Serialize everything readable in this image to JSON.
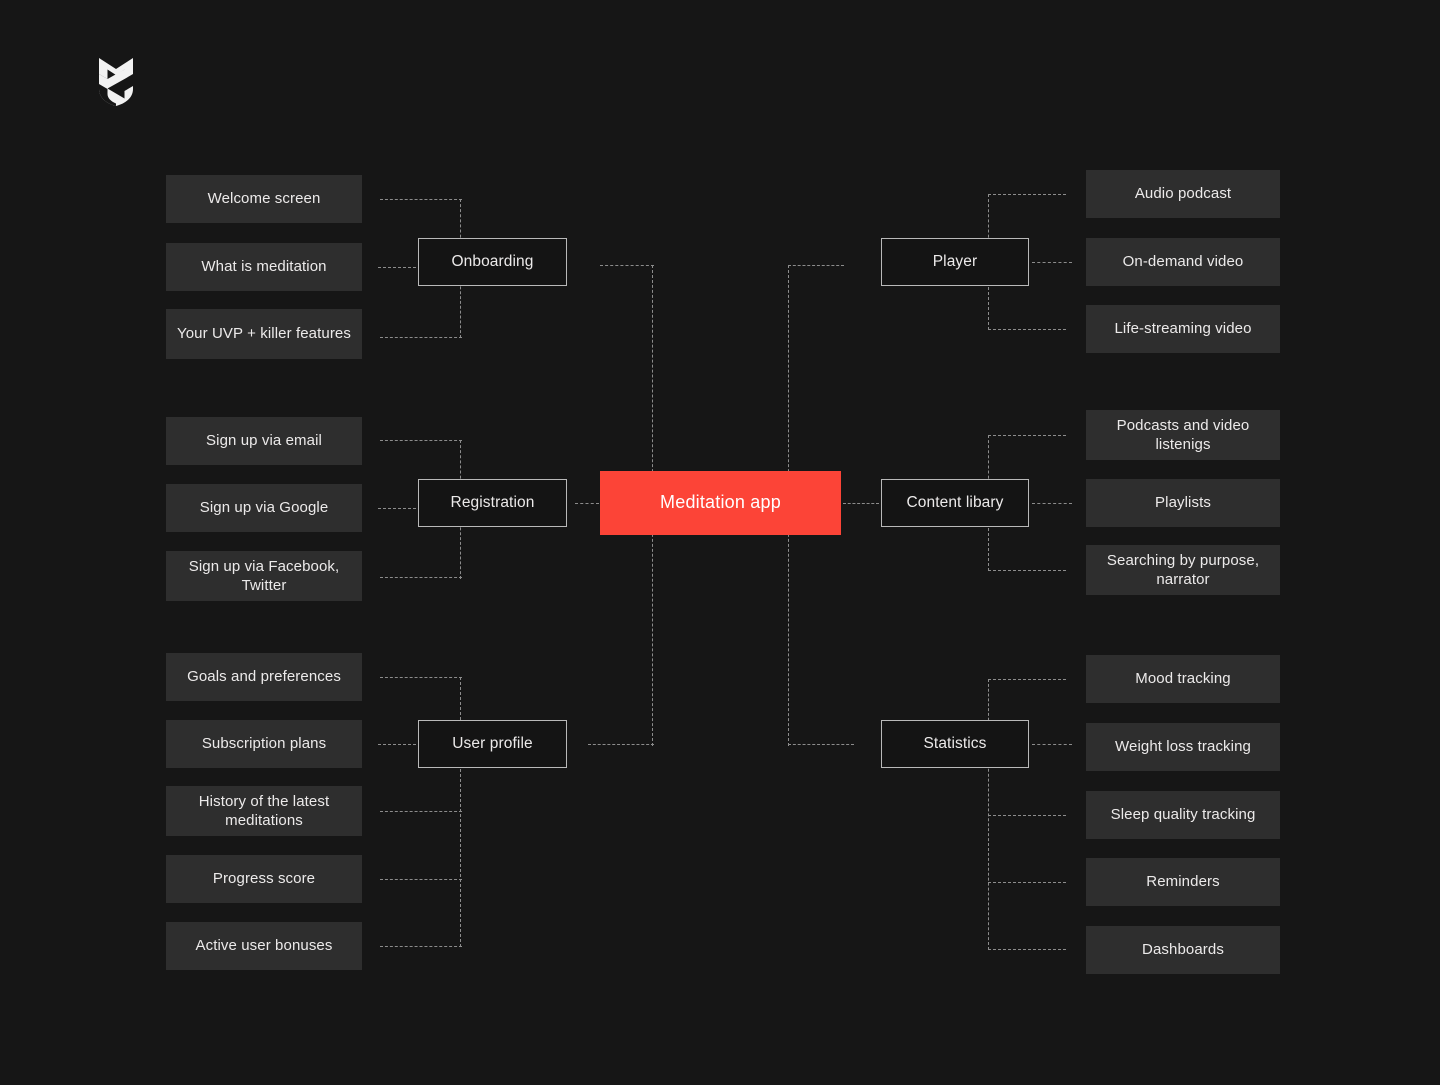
{
  "brand": {
    "logo_icon": "ms-monogram-shield-logo"
  },
  "root": {
    "label": "Meditation app",
    "color": "#fc4437"
  },
  "theme": {
    "background": "#161616",
    "leaf_fill": "#2e2e2e",
    "hub_border": "#b9b9b9",
    "connector": "#8c8c8c",
    "text": "#eceaea"
  },
  "sections": [
    {
      "id": "onboarding",
      "hub": "Onboarding",
      "side": "left",
      "leaves": [
        "Welcome screen",
        "What is meditation",
        "Your UVP + killer features"
      ]
    },
    {
      "id": "registration",
      "hub": "Registration",
      "side": "left",
      "leaves": [
        "Sign up via email",
        "Sign up via Google",
        "Sign up via Facebook, Twitter"
      ]
    },
    {
      "id": "user-profile",
      "hub": "User profile",
      "side": "left",
      "leaves": [
        "Goals and preferences",
        "Subscription plans",
        "History of the latest meditations",
        "Progress score",
        "Active user bonuses"
      ]
    },
    {
      "id": "player",
      "hub": "Player",
      "side": "right",
      "leaves": [
        "Audio podcast",
        "On-demand video",
        "Life-streaming video"
      ]
    },
    {
      "id": "content-libary",
      "hub": "Content libary",
      "side": "right",
      "leaves": [
        "Podcasts and video listenigs",
        "Playlists",
        "Searching by purpose, narrator"
      ]
    },
    {
      "id": "statistics",
      "hub": "Statistics",
      "side": "right",
      "leaves": [
        "Mood tracking",
        "Weight loss tracking",
        "Sleep quality tracking",
        "Reminders",
        "Dashboards"
      ]
    }
  ]
}
